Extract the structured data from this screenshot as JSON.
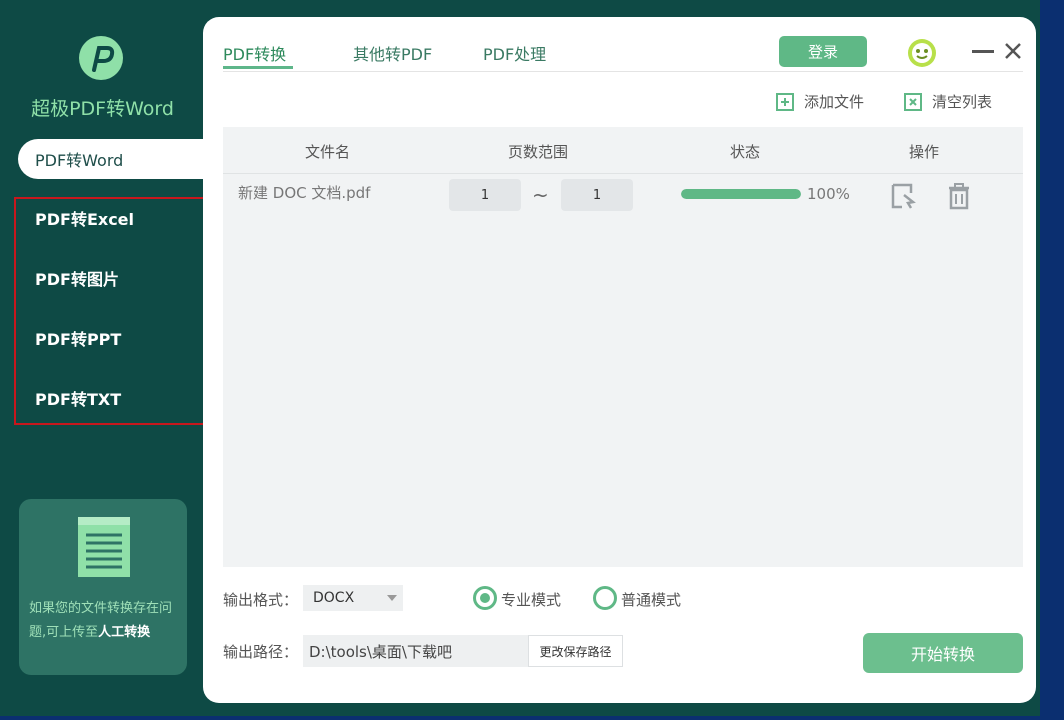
{
  "app": {
    "brand": "超极PDF转Word"
  },
  "sidebar": {
    "items": [
      {
        "label": "PDF转Word",
        "active": true
      },
      {
        "label": "PDF转Excel"
      },
      {
        "label": "PDF转图片"
      },
      {
        "label": "PDF转PPT"
      },
      {
        "label": "PDF转TXT"
      }
    ],
    "help_text": "如果您的文件转换存在问题,可上传至",
    "help_link": "人工转换"
  },
  "tabs": [
    {
      "label": "PDF转换",
      "active": true
    },
    {
      "label": "其他转PDF"
    },
    {
      "label": "PDF处理"
    }
  ],
  "header": {
    "login_label": "登录"
  },
  "toolbar": {
    "add_file": "添加文件",
    "clear_list": "清空列表"
  },
  "table": {
    "columns": [
      "文件名",
      "页数范围",
      "状态",
      "操作"
    ],
    "rows": [
      {
        "name": "新建 DOC 文档.pdf",
        "page_from": "1",
        "page_to": "1",
        "progress": 100,
        "progress_text": "100%"
      }
    ]
  },
  "options": {
    "format_label": "输出格式：",
    "format_value": "DOCX",
    "mode_pro": "专业模式",
    "mode_normal": "普通模式",
    "path_label": "输出路径：",
    "path_value": "D:\\tools\\桌面\\下载吧",
    "change_path": "更改保存路径",
    "start": "开始转换"
  },
  "colors": {
    "accent": "#5fb886",
    "sidebar_bg": "#0e4a45",
    "highlight": "#c8171d"
  }
}
